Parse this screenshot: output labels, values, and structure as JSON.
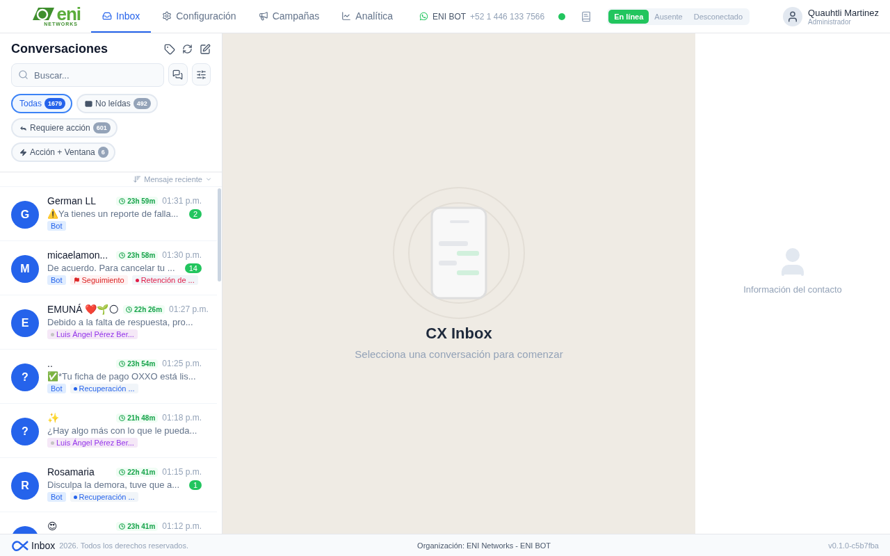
{
  "logo": {
    "wordmark": "eni",
    "subtitle": "NETWORKS"
  },
  "nav": [
    {
      "label": "Inbox",
      "selected": true
    },
    {
      "label": "Configuración",
      "selected": false
    },
    {
      "label": "Campañas",
      "selected": false
    },
    {
      "label": "Analítica",
      "selected": false
    }
  ],
  "channel": {
    "name": "ENI BOT",
    "phone": "+52 1 446 133 7566",
    "connected": true
  },
  "presence": [
    {
      "label": "En línea",
      "selected": true
    },
    {
      "label": "Ausente",
      "selected": false
    },
    {
      "label": "Desconectado",
      "selected": false
    }
  ],
  "user": {
    "name": "Quauhtli Martinez",
    "role": "Administrador"
  },
  "sidebar": {
    "title": "Conversaciones",
    "search": {
      "placeholder": "Buscar..."
    },
    "filters": [
      {
        "label": "Todas",
        "count": "1679",
        "selected": true
      },
      {
        "label": "No leídas",
        "count": "492",
        "selected": false
      },
      {
        "label": "Requiere acción",
        "count": "601",
        "selected": false
      },
      {
        "label": "Acción + Ventana",
        "count": "6",
        "selected": false
      }
    ],
    "sort": "Mensaje reciente",
    "conversations": [
      {
        "initial": "G",
        "name": "German LL",
        "timer": "23h 59m",
        "time": "01:31 p.m.",
        "preview": "⚠️Ya tienes un reporte de falla...",
        "unread": "2",
        "tags": [
          {
            "kind": "bot",
            "label": "Bot"
          }
        ]
      },
      {
        "initial": "M",
        "name": "micaelamon...",
        "timer": "23h 58m",
        "time": "01:30 p.m.",
        "preview": "De acuerdo. Para cancelar tu ...",
        "unread": "14",
        "tags": [
          {
            "kind": "bot",
            "label": "Bot"
          },
          {
            "kind": "flag",
            "label": "Seguimiento"
          },
          {
            "kind": "dot",
            "label": "Retención de ...",
            "color": "#e11d48"
          }
        ]
      },
      {
        "initial": "E",
        "name": "EMUNÁ ❤️🌱🌕",
        "timer": "22h 26m",
        "time": "01:27 p.m.",
        "preview": "Debido a la falta de respuesta, pro...",
        "tags": [
          {
            "kind": "agent",
            "label": "Luis Ángel Pérez Ber..."
          }
        ]
      },
      {
        "initial": "?",
        "name": "..",
        "timer": "23h 54m",
        "time": "01:25 p.m.",
        "preview": "✅*Tu ficha de pago OXXO está lis...",
        "tags": [
          {
            "kind": "bot",
            "label": "Bot"
          },
          {
            "kind": "dot",
            "label": "Recuperación ...",
            "color": "#2563eb"
          }
        ]
      },
      {
        "initial": "?",
        "name": "✨",
        "timer": "21h 48m",
        "time": "01:18 p.m.",
        "preview": "¿Hay algo más con lo que le pueda...",
        "tags": [
          {
            "kind": "agent",
            "label": "Luis Ángel Pérez Ber..."
          }
        ]
      },
      {
        "initial": "R",
        "name": "Rosamaria",
        "timer": "22h 41m",
        "time": "01:15 p.m.",
        "preview": "Disculpa la demora, tuve que a...",
        "unread": "1",
        "tags": [
          {
            "kind": "bot",
            "label": "Bot"
          },
          {
            "kind": "dot",
            "label": "Recuperación ...",
            "color": "#2563eb"
          }
        ]
      },
      {
        "name": "😍",
        "timer": "23h 41m",
        "time": "01:12 p.m."
      }
    ]
  },
  "empty_state": {
    "title": "CX Inbox",
    "subtitle": "Selecciona una conversación para comenzar"
  },
  "contact_panel": {
    "message": "Información del contacto"
  },
  "footer": {
    "brand": "Inbox",
    "copyright": "2026. Todos los derechos reservados.",
    "organization": "Organización: ENI Networks - ENI BOT",
    "version": "v0.1.0-c5b7fba"
  }
}
